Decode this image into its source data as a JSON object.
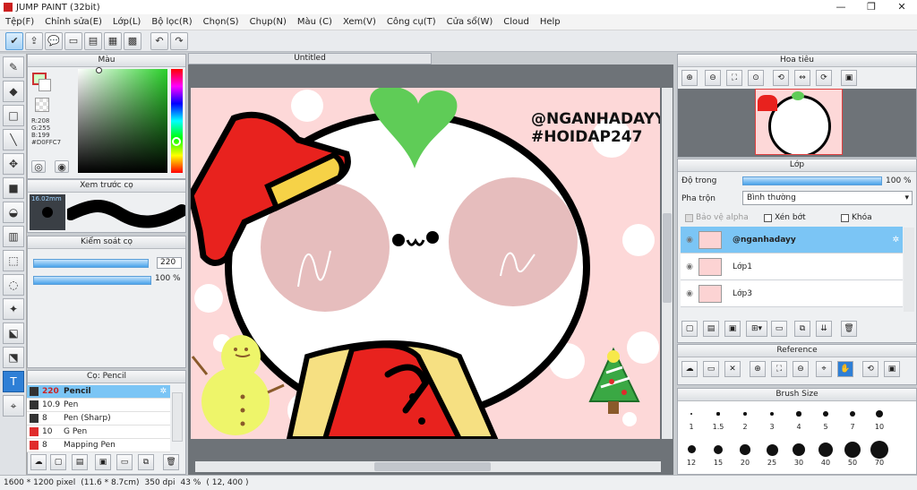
{
  "window": {
    "title": "JUMP PAINT (32bit)",
    "minimize": "—",
    "maximize": "❐",
    "close": "✕"
  },
  "menu": [
    "Tệp(F)",
    "Chỉnh sửa(E)",
    "Lớp(L)",
    "Bộ lọc(R)",
    "Chọn(S)",
    "Chụp(N)",
    "Màu (C)",
    "Xem(V)",
    "Công cụ(T)",
    "Cửa sổ(W)",
    "Cloud",
    "Help"
  ],
  "color_panel": {
    "title": "Màu",
    "r": "R:208",
    "g": "G:255",
    "b": "B:199",
    "hex": "#D0FFC7"
  },
  "brush_preview": {
    "title": "Xem trước cọ",
    "size": "16.02mm"
  },
  "brush_control": {
    "title": "Kiểm soát cọ",
    "size_value": "220",
    "opacity_value": "100 %",
    "size_fraction": 0.98,
    "opacity_fraction": 1.0
  },
  "brush_list": {
    "title": "Cọ: Pencil",
    "items": [
      {
        "size": "220",
        "name": "Pencil",
        "selected": true,
        "color": "#333333"
      },
      {
        "size": "10.9",
        "name": "Pen",
        "selected": false,
        "color": "#333333"
      },
      {
        "size": "8",
        "name": "Pen (Sharp)",
        "selected": false,
        "color": "#333333"
      },
      {
        "size": "10",
        "name": "G Pen",
        "selected": false,
        "color": "#e02b2b"
      },
      {
        "size": "8",
        "name": "Mapping Pen",
        "selected": false,
        "color": "#e02b2b"
      }
    ]
  },
  "canvas": {
    "tab": "Untitled",
    "handle_line1": "@NGANHADAYY",
    "handle_line2": "#HOIDAP247"
  },
  "navigator": {
    "title": "Hoa tiêu"
  },
  "layer_panel": {
    "title": "Lớp",
    "opacity_label": "Độ trong",
    "opacity_value": "100 %",
    "opacity_fraction": 1.0,
    "blend_label": "Pha trộn",
    "blend_value": "Bình thường",
    "protect_alpha": "Bảo vệ alpha",
    "clipping": "Xén bớt",
    "lock": "Khóa",
    "layers": [
      {
        "name": "@nganhadayy",
        "selected": true
      },
      {
        "name": "Lớp1",
        "selected": false
      },
      {
        "name": "Lớp3",
        "selected": false
      }
    ]
  },
  "reference_panel": {
    "title": "Reference"
  },
  "brush_size_panel": {
    "title": "Brush Size",
    "sizes": [
      "1",
      "1.5",
      "2",
      "3",
      "4",
      "5",
      "7",
      "10",
      "12",
      "15",
      "20",
      "25",
      "30",
      "40",
      "50",
      "70"
    ]
  },
  "status": {
    "pixels": "1600 * 1200 pixel",
    "physical": "(11.6 * 8.7cm)",
    "dpi": "350 dpi",
    "zoom": "43 %",
    "coords": "( 12, 400 )"
  }
}
